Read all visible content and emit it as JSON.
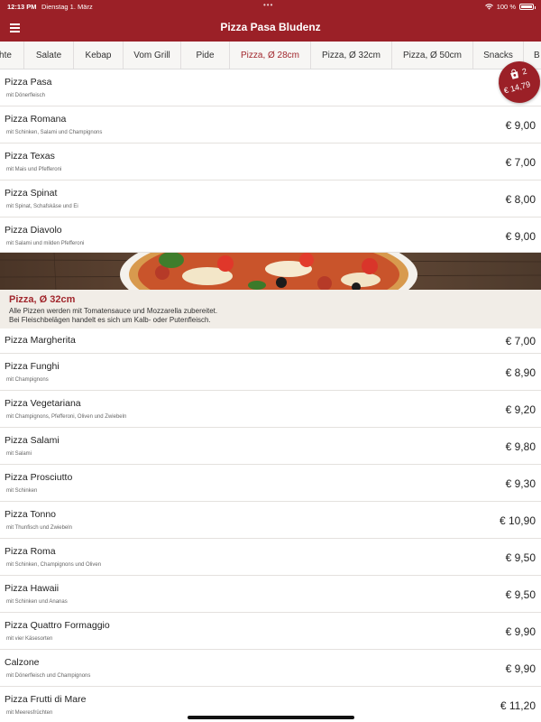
{
  "status_bar": {
    "time": "12:13 PM",
    "date": "Dienstag 1. März",
    "battery": "100 %"
  },
  "header": {
    "title": "Pizza Pasa Bludenz"
  },
  "tabs": [
    {
      "label": "hte"
    },
    {
      "label": "Salate"
    },
    {
      "label": "Kebap"
    },
    {
      "label": "Vom Grill"
    },
    {
      "label": "Pide"
    },
    {
      "label": "Pizza, Ø 28cm"
    },
    {
      "label": "Pizza, Ø 32cm"
    },
    {
      "label": "Pizza, Ø 50cm"
    },
    {
      "label": "Snacks"
    },
    {
      "label": "B"
    }
  ],
  "cart": {
    "count": "2",
    "total": "€ 14,79"
  },
  "section_28": {
    "items": [
      {
        "name": "Pizza Pasa",
        "desc": "mit Dönerfleisch",
        "price": ""
      },
      {
        "name": "Pizza Romana",
        "desc": "mit Schinken, Salami und Champignons",
        "price": "€ 9,00"
      },
      {
        "name": "Pizza Texas",
        "desc": "mit Mais und Pfefferoni",
        "price": "€ 7,00"
      },
      {
        "name": "Pizza Spinat",
        "desc": "mit Spinat, Schafskäse und Ei",
        "price": "€ 8,00"
      },
      {
        "name": "Pizza Diavolo",
        "desc": "mit Salami und milden Pfefferoni",
        "price": "€ 9,00"
      }
    ]
  },
  "section_32": {
    "title": "Pizza, Ø 32cm",
    "desc_line1": "Alle Pizzen werden mit Tomatensauce und Mozzarella zubereitet.",
    "desc_line2": "Bei Fleischbelägen handelt es sich um Kalb- oder Putenfleisch.",
    "items": [
      {
        "name": "Pizza Margherita",
        "desc": "",
        "price": "€ 7,00"
      },
      {
        "name": "Pizza Funghi",
        "desc": "mit Champignons",
        "price": "€ 8,90"
      },
      {
        "name": "Pizza Vegetariana",
        "desc": "mit Champignons, Pfefferoni, Oliven und Zwiebeln",
        "price": "€ 9,20"
      },
      {
        "name": "Pizza Salami",
        "desc": "mit Salami",
        "price": "€ 9,80"
      },
      {
        "name": "Pizza Prosciutto",
        "desc": "mit Schinken",
        "price": "€ 9,30"
      },
      {
        "name": "Pizza Tonno",
        "desc": "mit Thunfisch und Zwiebeln",
        "price": "€ 10,90"
      },
      {
        "name": "Pizza Roma",
        "desc": "mit Schinken, Champignons und Oliven",
        "price": "€ 9,50"
      },
      {
        "name": "Pizza Hawaii",
        "desc": "mit Schinken und Ananas",
        "price": "€ 9,50"
      },
      {
        "name": "Pizza Quattro Formaggio",
        "desc": "mit vier Käsesorten",
        "price": "€ 9,90"
      },
      {
        "name": "Calzone",
        "desc": "mit Dönerfleisch und Champignons",
        "price": "€ 9,90"
      },
      {
        "name": "Pizza Frutti di Mare",
        "desc": "mit Meeresfrüchten",
        "price": "€ 11,20"
      }
    ]
  }
}
